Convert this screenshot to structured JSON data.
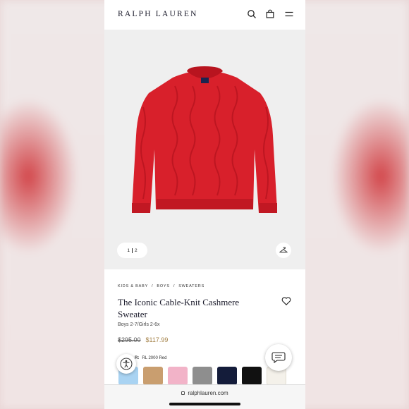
{
  "header": {
    "logo": "RALPH LAUREN",
    "icons": [
      "search-icon",
      "shopping-bag-icon",
      "menu-icon"
    ]
  },
  "gallery": {
    "current_page": "1",
    "total_pages": "2",
    "hanger_icon": "hanger-icon"
  },
  "product": {
    "breadcrumbs": [
      "KIDS & BABY",
      "/",
      "BOYS",
      "/",
      "SWEATERS"
    ],
    "title": "The Iconic Cable-Knit Cashmere Sweater",
    "subtitle": "Boys 2-7/Girls 2-6x",
    "original_price": "$295.00",
    "sale_price": "$117.99",
    "color_label": "R:",
    "color_value": "RL 2000 Red"
  },
  "swatches": [
    {
      "color": "#a9d3f2"
    },
    {
      "color": "#c99e6f"
    },
    {
      "color": "#f2b3c8"
    },
    {
      "color": "#8e8e8e"
    },
    {
      "color": "#141c3a"
    },
    {
      "color": "#111111"
    },
    {
      "color": "#f4f1ea"
    }
  ],
  "browser": {
    "url": "ralphlauren.com"
  },
  "colors": {
    "sweater": "#d8202b",
    "price_sale": "#a5834a"
  }
}
